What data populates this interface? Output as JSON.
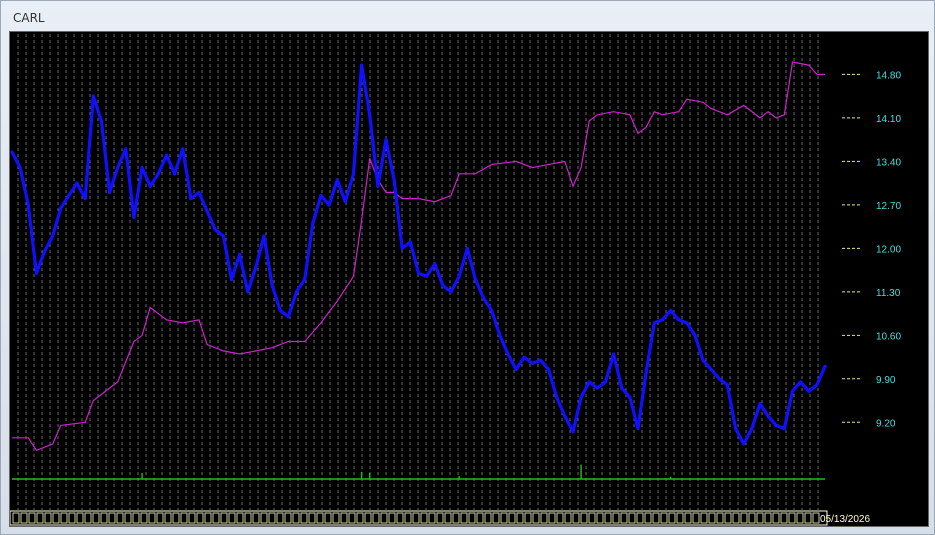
{
  "window": {
    "title": "CARL"
  },
  "colors": {
    "background": "#000000",
    "grid": "#e8e8e8",
    "price": "#1010ff",
    "average": "#d020d0",
    "volume": "#22bb22",
    "axis_label": "#40e0e0",
    "tick": "#e8e880",
    "date_strip": "#ffffcc"
  },
  "chart_data": {
    "type": "line",
    "title": "",
    "xlabel": "",
    "ylabel": "",
    "ylim": [
      8.4,
      15.45
    ],
    "y_ticks": [
      14.8,
      14.1,
      13.4,
      12.7,
      12.0,
      11.3,
      10.6,
      9.9,
      9.2
    ],
    "y_tick_labels": [
      "14.80",
      "14.10",
      "13.40",
      "12.70",
      "12.00",
      "11.30",
      "10.60",
      "9.90",
      "9.20"
    ],
    "grid": "vertical dashed",
    "x_index_range": [
      0,
      100
    ],
    "last_date_label": "05/13/2026",
    "series": [
      {
        "style": "thick",
        "points": [
          [
            0,
            13.55
          ],
          [
            1,
            13.3
          ],
          [
            2,
            12.7
          ],
          [
            3,
            11.6
          ],
          [
            4,
            11.95
          ],
          [
            5,
            12.2
          ],
          [
            6,
            12.65
          ],
          [
            7,
            12.85
          ],
          [
            8,
            13.05
          ],
          [
            9,
            12.8
          ],
          [
            10,
            14.45
          ],
          [
            11,
            14.05
          ],
          [
            12,
            12.9
          ],
          [
            13,
            13.3
          ],
          [
            14,
            13.6
          ],
          [
            15,
            12.5
          ],
          [
            16,
            13.3
          ],
          [
            17,
            13.0
          ],
          [
            18,
            13.2
          ],
          [
            19,
            13.5
          ],
          [
            20,
            13.2
          ],
          [
            21,
            13.6
          ],
          [
            22,
            12.8
          ],
          [
            23,
            12.9
          ],
          [
            24,
            12.6
          ],
          [
            25,
            12.3
          ],
          [
            26,
            12.2
          ],
          [
            27,
            11.5
          ],
          [
            28,
            11.9
          ],
          [
            29,
            11.3
          ],
          [
            30,
            11.7
          ],
          [
            31,
            12.2
          ],
          [
            32,
            11.4
          ],
          [
            33,
            11.0
          ],
          [
            34,
            10.9
          ],
          [
            35,
            11.3
          ],
          [
            36,
            11.5
          ],
          [
            37,
            12.4
          ],
          [
            38,
            12.85
          ],
          [
            39,
            12.7
          ],
          [
            40,
            13.1
          ],
          [
            41,
            12.75
          ],
          [
            42,
            13.2
          ],
          [
            43,
            14.95
          ],
          [
            44,
            14.15
          ],
          [
            45,
            13.0
          ],
          [
            46,
            13.75
          ],
          [
            47,
            13.1
          ],
          [
            48,
            12.0
          ],
          [
            49,
            12.1
          ],
          [
            50,
            11.6
          ],
          [
            51,
            11.55
          ],
          [
            52,
            11.75
          ],
          [
            53,
            11.4
          ],
          [
            54,
            11.3
          ],
          [
            55,
            11.55
          ],
          [
            56,
            12.0
          ],
          [
            57,
            11.5
          ],
          [
            58,
            11.2
          ],
          [
            59,
            11.0
          ],
          [
            60,
            10.6
          ],
          [
            61,
            10.3
          ],
          [
            62,
            10.05
          ],
          [
            63,
            10.25
          ],
          [
            64,
            10.15
          ],
          [
            65,
            10.2
          ],
          [
            66,
            10.05
          ],
          [
            67,
            9.6
          ],
          [
            68,
            9.3
          ],
          [
            69,
            9.05
          ],
          [
            70,
            9.6
          ],
          [
            71,
            9.85
          ],
          [
            72,
            9.75
          ],
          [
            73,
            9.85
          ],
          [
            74,
            10.3
          ],
          [
            75,
            9.75
          ],
          [
            76,
            9.6
          ],
          [
            77,
            9.1
          ],
          [
            78,
            10.0
          ],
          [
            79,
            10.8
          ],
          [
            80,
            10.85
          ],
          [
            81,
            11.0
          ],
          [
            82,
            10.85
          ],
          [
            83,
            10.8
          ],
          [
            84,
            10.6
          ],
          [
            85,
            10.2
          ],
          [
            86,
            10.05
          ],
          [
            87,
            9.9
          ],
          [
            88,
            9.8
          ],
          [
            89,
            9.1
          ],
          [
            90,
            8.85
          ],
          [
            91,
            9.1
          ],
          [
            92,
            9.5
          ],
          [
            93,
            9.3
          ],
          [
            94,
            9.15
          ],
          [
            95,
            9.1
          ],
          [
            96,
            9.7
          ],
          [
            97,
            9.85
          ],
          [
            98,
            9.7
          ],
          [
            99,
            9.8
          ],
          [
            100,
            10.1
          ]
        ]
      },
      {
        "style": "thin",
        "points": [
          [
            0,
            8.95
          ],
          [
            2,
            8.95
          ],
          [
            3,
            8.75
          ],
          [
            5,
            8.85
          ],
          [
            6,
            9.15
          ],
          [
            9,
            9.2
          ],
          [
            10,
            9.55
          ],
          [
            13,
            9.85
          ],
          [
            15,
            10.5
          ],
          [
            16,
            10.6
          ],
          [
            17,
            11.05
          ],
          [
            19,
            10.85
          ],
          [
            21,
            10.8
          ],
          [
            23,
            10.85
          ],
          [
            24,
            10.45
          ],
          [
            26,
            10.35
          ],
          [
            28,
            10.3
          ],
          [
            30,
            10.35
          ],
          [
            32,
            10.4
          ],
          [
            34,
            10.5
          ],
          [
            36,
            10.5
          ],
          [
            38,
            10.8
          ],
          [
            40,
            11.15
          ],
          [
            42,
            11.55
          ],
          [
            43,
            12.45
          ],
          [
            44,
            13.45
          ],
          [
            45,
            13.1
          ],
          [
            46,
            12.9
          ],
          [
            47,
            12.9
          ],
          [
            48,
            12.8
          ],
          [
            50,
            12.8
          ],
          [
            52,
            12.75
          ],
          [
            54,
            12.85
          ],
          [
            55,
            13.2
          ],
          [
            57,
            13.2
          ],
          [
            59,
            13.35
          ],
          [
            62,
            13.4
          ],
          [
            64,
            13.3
          ],
          [
            68,
            13.4
          ],
          [
            69,
            13.0
          ],
          [
            70,
            13.3
          ],
          [
            71,
            14.05
          ],
          [
            72,
            14.15
          ],
          [
            74,
            14.2
          ],
          [
            76,
            14.15
          ],
          [
            77,
            13.85
          ],
          [
            78,
            13.95
          ],
          [
            79,
            14.2
          ],
          [
            80,
            14.15
          ],
          [
            82,
            14.2
          ],
          [
            83,
            14.4
          ],
          [
            85,
            14.35
          ],
          [
            86,
            14.25
          ],
          [
            88,
            14.15
          ],
          [
            90,
            14.3
          ],
          [
            92,
            14.1
          ],
          [
            93,
            14.2
          ],
          [
            94,
            14.1
          ],
          [
            95,
            14.15
          ],
          [
            96,
            15.0
          ],
          [
            98,
            14.95
          ],
          [
            99,
            14.8
          ],
          [
            100,
            14.8
          ]
        ]
      },
      {
        "style": "bars",
        "spikes": [
          [
            16,
            1.0
          ],
          [
            43,
            1.2
          ],
          [
            44,
            1.0
          ],
          [
            55,
            0.5
          ],
          [
            70,
            2.4
          ],
          [
            81,
            0.4
          ]
        ]
      }
    ]
  }
}
